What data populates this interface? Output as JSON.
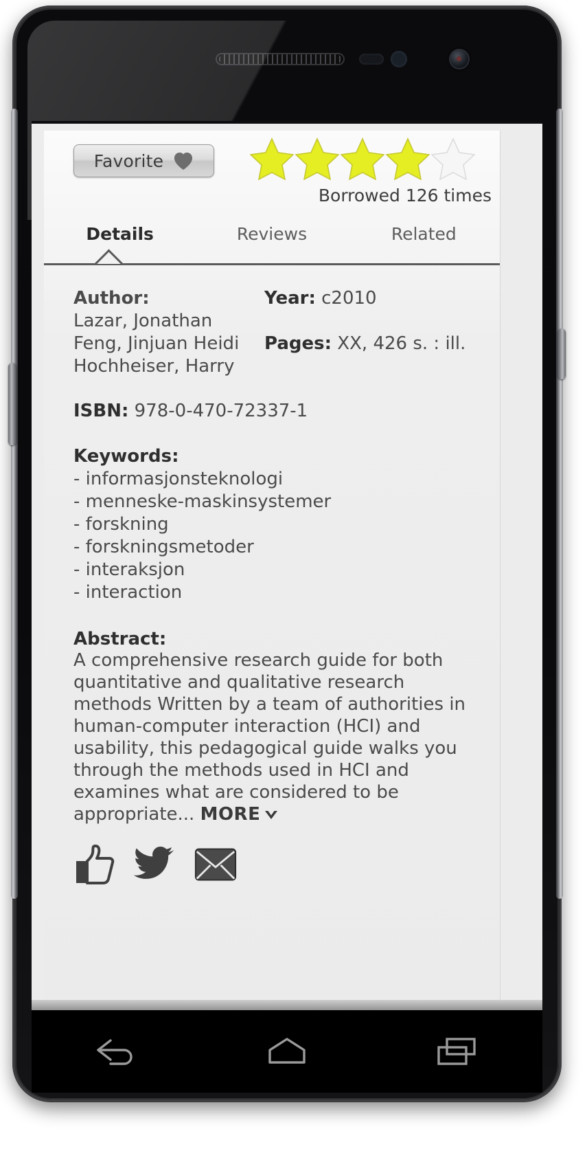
{
  "device": {
    "name": "android-phone",
    "hardware": {
      "earpiece": "earpiece-speaker",
      "proximity_sensor": "proximity-sensor",
      "light_sensor": "light-sensor",
      "front_camera": "front-camera"
    }
  },
  "app": {
    "favorite": {
      "label": "Favorite",
      "icon": "heart-icon"
    },
    "rating": {
      "filled": 4,
      "total": 5,
      "filled_color": "#e4ee22",
      "empty_color": "#f4f4f4"
    },
    "borrowed": "Borrowed 126 times",
    "tabs": [
      {
        "label": "Details",
        "active": true
      },
      {
        "label": "Reviews",
        "active": false
      },
      {
        "label": "Related",
        "active": false
      }
    ],
    "details": {
      "author_label": "Author:",
      "authors": [
        "Lazar, Jonathan",
        "Feng, Jinjuan Heidi",
        "Hochheiser, Harry"
      ],
      "year_label": "Year:",
      "year_value": "c2010",
      "pages_label": "Pages:",
      "pages_value": "XX, 426 s. : ill.",
      "isbn_label": "ISBN:",
      "isbn_value": "978-0-470-72337-1",
      "keywords_label": "Keywords:",
      "keywords": [
        "- informasjonsteknologi",
        "- menneske-maskinsystemer",
        "- forskning",
        "- forskningsmetoder",
        "- interaksjon",
        "- interaction"
      ],
      "abstract_label": "Abstract:",
      "abstract_text": "A comprehensive research guide for both quantitative and qualitative research methods Written by a team of authorities in human-computer interaction (HCI) and usability, this pedagogical guide walks you through the methods used in HCI and examines what are considered to be appropriate... ",
      "more_label": "MORE",
      "more_icon": "chevron-down-icon"
    },
    "social": [
      {
        "name": "thumbs-up-icon",
        "label": "Like"
      },
      {
        "name": "twitter-bird-icon",
        "label": "Tweet"
      },
      {
        "name": "envelope-icon",
        "label": "Email"
      }
    ]
  },
  "navbar": {
    "buttons": [
      {
        "name": "back-button",
        "icon": "back-arrow-icon"
      },
      {
        "name": "home-button",
        "icon": "home-icon"
      },
      {
        "name": "recents-button",
        "icon": "recents-icon"
      }
    ]
  }
}
